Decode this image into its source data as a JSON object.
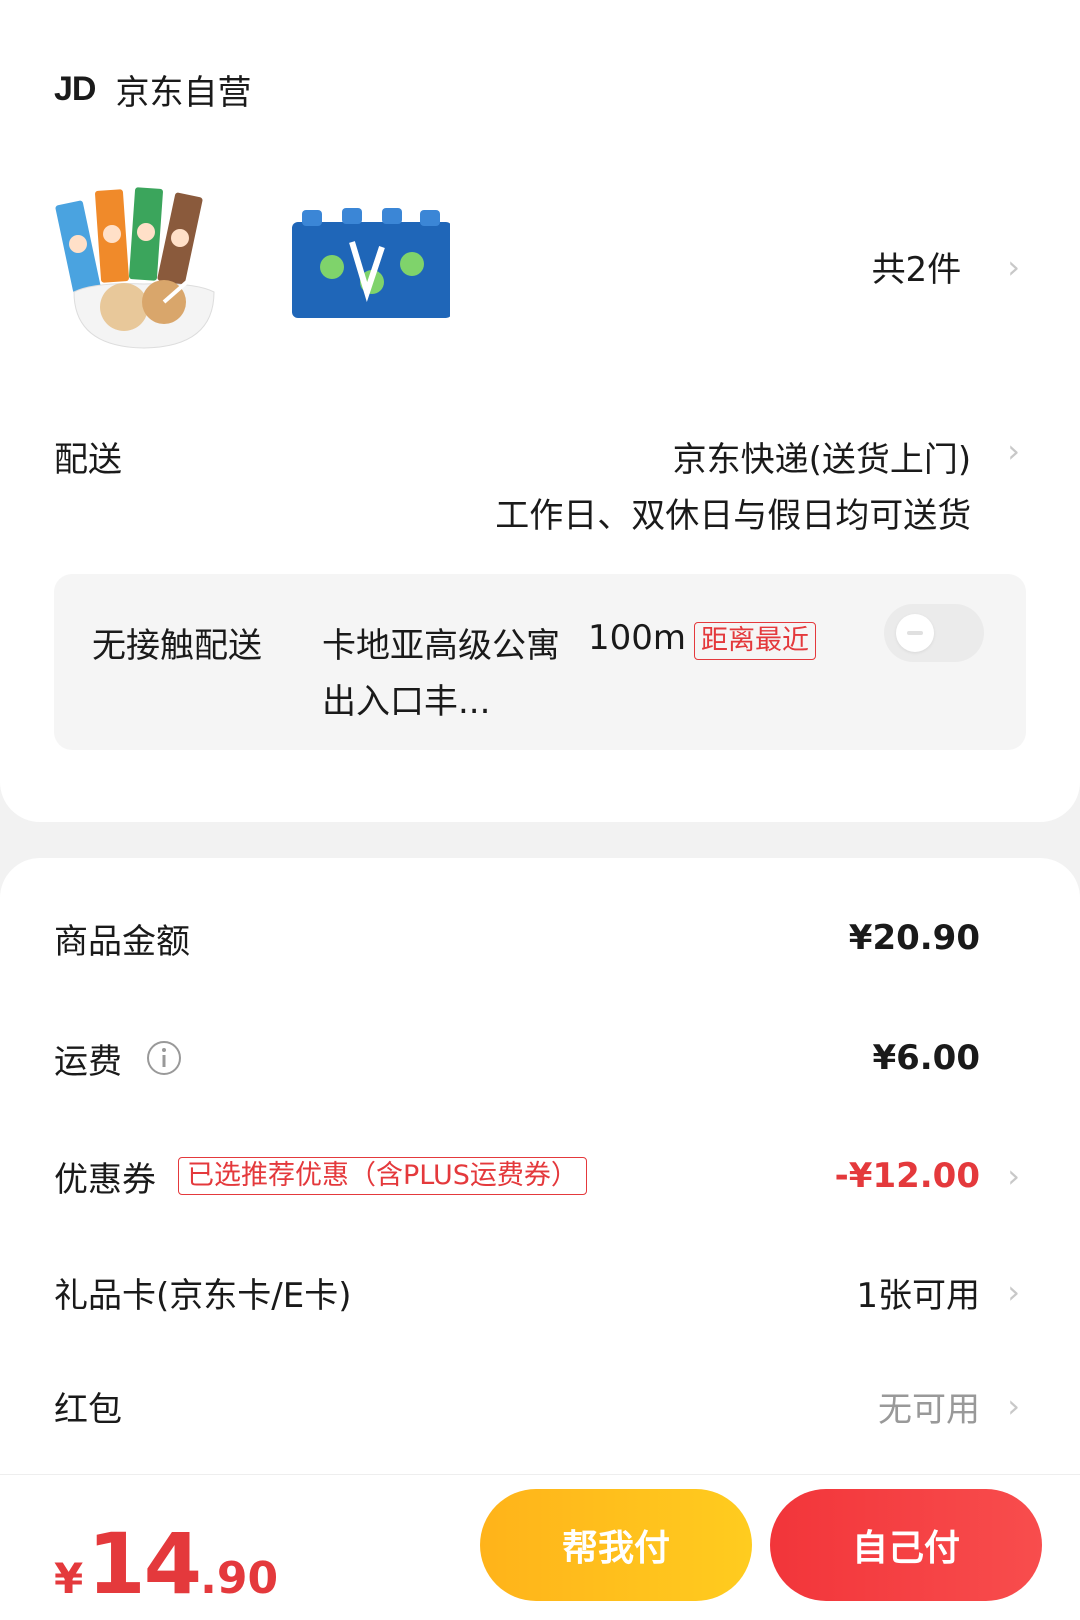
{
  "store": {
    "logo": "JD",
    "name": "京东自营"
  },
  "products": {
    "items": [
      "peko-candy",
      "maidong-drink"
    ],
    "count_label": "共2件"
  },
  "shipping": {
    "label": "配送",
    "method": "京东快递(送货上门)",
    "schedule": "工作日、双休日与假日均可送货"
  },
  "contactless": {
    "label": "无接触配送",
    "address": "卡地亚高级公寓出入口丰...",
    "distance": "100m",
    "tag": "距离最近",
    "toggle_on": false
  },
  "fees": {
    "goods": {
      "label": "商品金额",
      "value": "¥20.90"
    },
    "freight": {
      "label": "运费",
      "value": "¥6.00"
    },
    "coupon": {
      "label": "优惠券",
      "tag": "已选推荐优惠（含PLUS运费券）",
      "value": "-¥12.00"
    },
    "gift_card": {
      "label": "礼品卡(京东卡/E卡)",
      "value": "1张可用"
    },
    "red_packet": {
      "label": "红包",
      "value": "无可用"
    }
  },
  "footer": {
    "currency": "¥",
    "total_int": "14",
    "total_dec": ".90",
    "help_pay": "帮我付",
    "self_pay": "自己付"
  },
  "colors": {
    "accent_red": "#e4393c",
    "help_yellow": "#ffb31a",
    "self_red": "#f2353a"
  }
}
